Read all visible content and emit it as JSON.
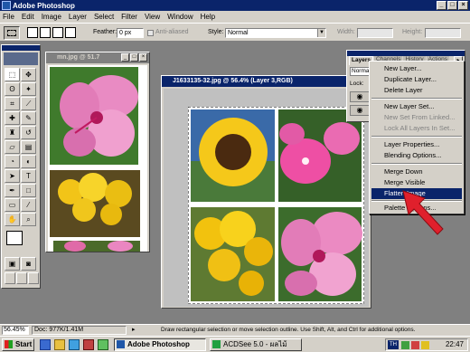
{
  "app": {
    "title": "Adobe Photoshop"
  },
  "menubar": {
    "items": [
      "File",
      "Edit",
      "Image",
      "Layer",
      "Select",
      "Filter",
      "View",
      "Window",
      "Help"
    ]
  },
  "options": {
    "feather_label": "Feather:",
    "feather_value": "0 px",
    "antialiased_label": "Anti-aliased",
    "style_label": "Style:",
    "style_value": "Normal",
    "width_label": "Width:",
    "height_label": "Height:"
  },
  "doc_small": {
    "title": "mn.jpg @ 51.7"
  },
  "doc_main": {
    "title": "J1633135-32.jpg @ 56.4% (Layer 3,RGB)"
  },
  "layers_panel": {
    "tabs": [
      "Layers",
      "Channels",
      "History",
      "Actions"
    ],
    "blend_mode": "Normal",
    "lock_label": "Lock:"
  },
  "context_menu": {
    "items": [
      {
        "label": "New Layer...",
        "disabled": false
      },
      {
        "label": "Duplicate Layer...",
        "disabled": false
      },
      {
        "label": "Delete Layer",
        "disabled": false
      },
      {
        "label": "New Layer Set...",
        "disabled": false
      },
      {
        "label": "New Set From Linked...",
        "disabled": true
      },
      {
        "label": "Lock All Layers In Set...",
        "disabled": true
      },
      {
        "label": "Layer Properties...",
        "disabled": false
      },
      {
        "label": "Blending Options...",
        "disabled": false
      },
      {
        "label": "Merge Down",
        "disabled": false
      },
      {
        "label": "Merge Visible",
        "disabled": false
      },
      {
        "label": "Flatten Image",
        "disabled": false,
        "selected": true
      },
      {
        "label": "Palette Options...",
        "disabled": false
      }
    ]
  },
  "statusbar": {
    "zoom": "56.45%",
    "doc_size": "Doc: 977K/1.41M",
    "hint": "Draw rectangular selection or move selection outline. Use Shift, Alt, and Ctrl for additional options."
  },
  "taskbar": {
    "start": "Start",
    "tasks": [
      "Adobe Photoshop",
      "ACDSee 5.0 - ผลไม้"
    ],
    "clock": "22:47",
    "tray_lang": "TH"
  },
  "colors": {
    "title_active": "#0a246a",
    "face": "#d4d0c8",
    "workspace": "#808080",
    "arrow": "#e0202c"
  }
}
